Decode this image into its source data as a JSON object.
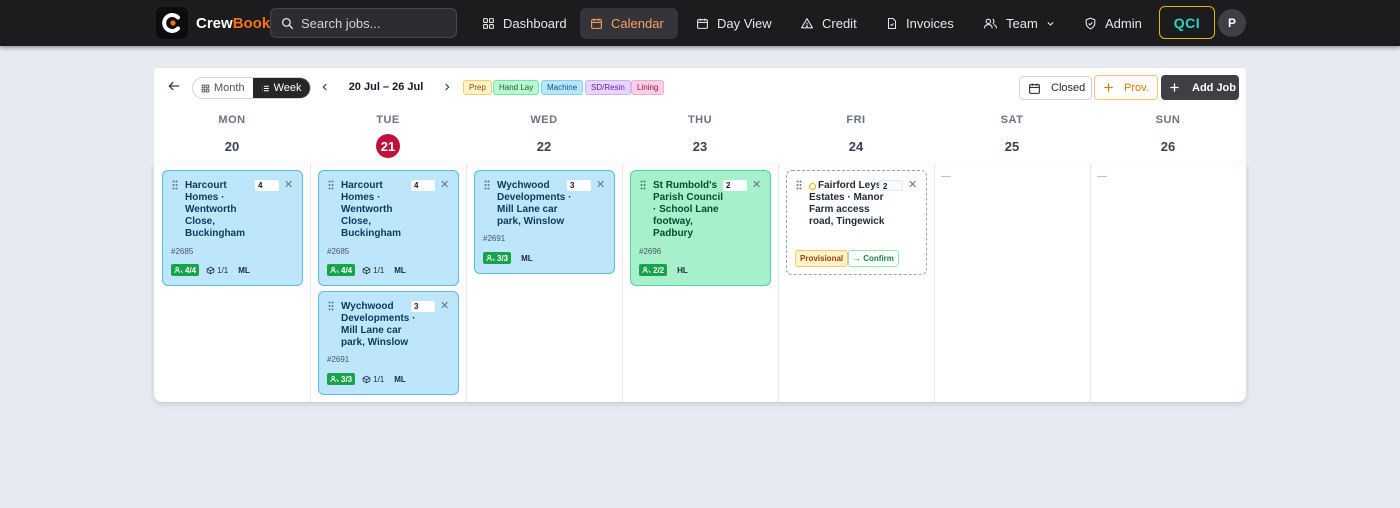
{
  "brand": {
    "name_part1": "Crew",
    "name_part2": "Book"
  },
  "search": {
    "placeholder": "Search jobs..."
  },
  "nav": {
    "dashboard": "Dashboard",
    "calendar": "Calendar",
    "day_view": "Day View",
    "credit": "Credit",
    "invoices": "Invoices",
    "team": "Team",
    "admin": "Admin",
    "qci": "QCI",
    "avatar_initial": "P"
  },
  "toolbar": {
    "month": "Month",
    "week": "Week",
    "range": "20 Jul – 26 Jul",
    "legend": {
      "prep": "Prep",
      "hand_lay": "Hand Lay",
      "machine": "Machine",
      "sd_resin": "SD/Resin",
      "lining": "Lining"
    },
    "closed": "Closed",
    "prov": "Prov.",
    "add_job": "Add Job"
  },
  "days": [
    {
      "name": "MON",
      "num": "20"
    },
    {
      "name": "TUE",
      "num": "21",
      "today": true
    },
    {
      "name": "WED",
      "num": "22"
    },
    {
      "name": "THU",
      "num": "23"
    },
    {
      "name": "FRI",
      "num": "24"
    },
    {
      "name": "SAT",
      "num": "25"
    },
    {
      "name": "SUN",
      "num": "26"
    }
  ],
  "empty_marker": "—",
  "jobs": {
    "mon1": {
      "title": "Harcourt Homes · Wentworth Close, Buckingham",
      "qty": "4",
      "number": "#2685",
      "crew": "4/4",
      "vehicles": "1/1",
      "tag": "ML"
    },
    "tue1": {
      "title": "Harcourt Homes · Wentworth Close, Buckingham",
      "qty": "4",
      "number": "#2685",
      "crew": "4/4",
      "vehicles": "1/1",
      "tag": "ML"
    },
    "tue2": {
      "title": "Wychwood Developments · Mill Lane car park, Winslow",
      "qty": "3",
      "number": "#2691",
      "crew": "3/3",
      "vehicles": "1/1",
      "tag": "ML"
    },
    "wed1": {
      "title": "Wychwood Developments · Mill Lane car park, Winslow",
      "qty": "3",
      "number": "#2691",
      "crew": "3/3",
      "tag": "ML"
    },
    "thu1": {
      "title": "St Rumbold's Parish Council · School Lane footway, Padbury",
      "qty": "2",
      "number": "#2696",
      "crew": "2/2",
      "tag": "HL"
    },
    "fri1": {
      "title": "Fairford Leys Estates · Manor Farm access road, Tingewick",
      "qty": "2",
      "badge": "Provisional",
      "confirm": "→ Confirm"
    }
  },
  "colors": {
    "accent_orange": "#f97316",
    "today_red": "#be123c",
    "machine_blue": "#bde6fb",
    "hand_lay_green": "#a7f0cc",
    "crew_green": "#16a34a",
    "qci_teal": "#2dd4bf",
    "qci_border": "#eab308"
  }
}
